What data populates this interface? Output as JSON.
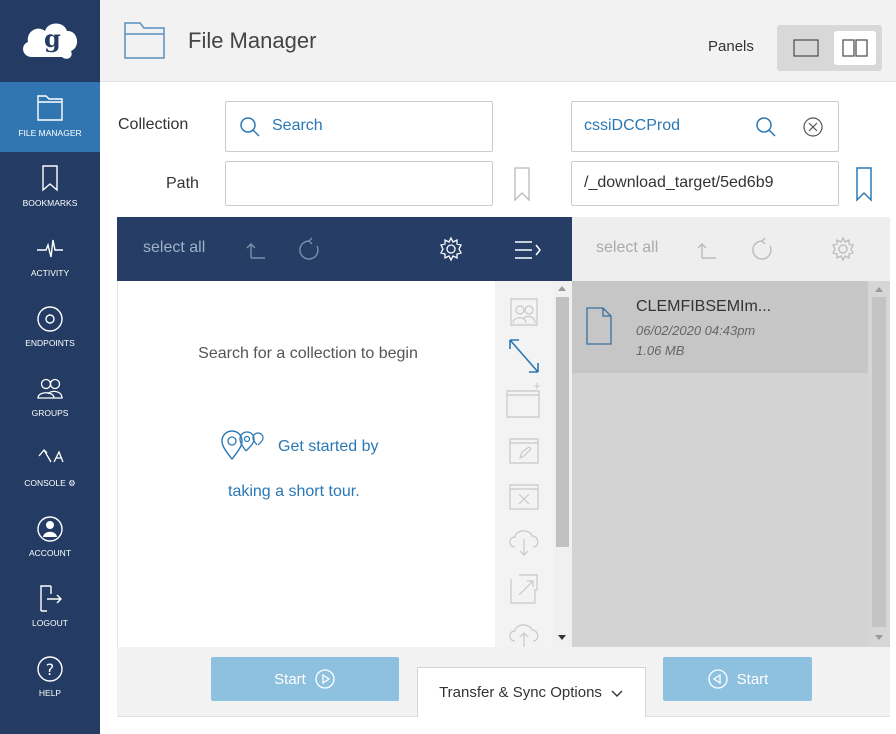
{
  "sidebar": {
    "items": [
      {
        "label": "FILE MANAGER",
        "icon": "folder-icon",
        "active": true
      },
      {
        "label": "BOOKMARKS",
        "icon": "bookmark-icon"
      },
      {
        "label": "ACTIVITY",
        "icon": "activity-pulse-icon"
      },
      {
        "label": "ENDPOINTS",
        "icon": "endpoint-disc-icon"
      },
      {
        "label": "GROUPS",
        "icon": "groups-icon"
      },
      {
        "label": "CONSOLE",
        "icon": "console-icon",
        "suffix": "⚙"
      },
      {
        "label": "ACCOUNT",
        "icon": "account-icon"
      },
      {
        "label": "LOGOUT",
        "icon": "logout-icon"
      },
      {
        "label": "HELP",
        "icon": "help-icon"
      }
    ]
  },
  "header": {
    "title": "File Manager",
    "panels_label": "Panels"
  },
  "form": {
    "collection_label": "Collection",
    "path_label": "Path",
    "left_collection_placeholder": "Search",
    "right_collection_value": "cssiDCCProd",
    "right_path_value": "/_download_target/5ed6b9"
  },
  "toolbar": {
    "select_all": "select all"
  },
  "left_panel": {
    "message": "Search for a collection to begin",
    "tour_line1": "Get started by",
    "tour_line2": "taking a short tour."
  },
  "right_panel": {
    "file": {
      "name": "CLEMFIBSEMIm...",
      "date": "06/02/2020 04:43pm",
      "size": "1.06 MB"
    }
  },
  "footer": {
    "start_label": "Start",
    "sync_label": "Transfer & Sync Options"
  },
  "colors": {
    "sidebar": "#243c63",
    "active": "#3276b1",
    "accent": "#2a78b5",
    "start_button": "#8ec0df"
  }
}
